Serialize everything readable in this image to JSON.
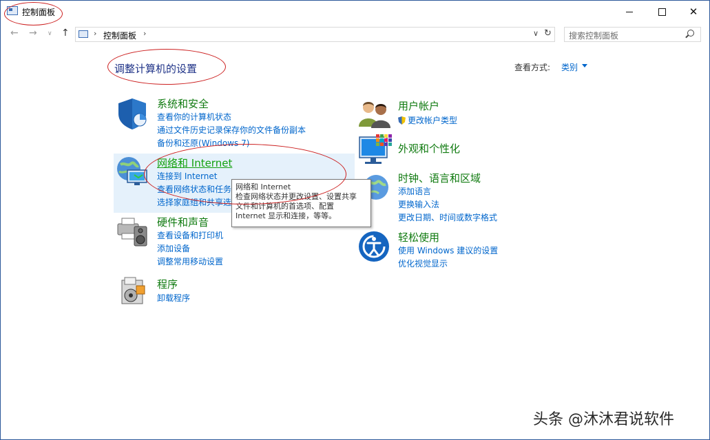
{
  "window": {
    "title": "控制面板"
  },
  "navbar": {
    "back_icon": "←",
    "forward_icon": "→",
    "recent_icon": "∨",
    "up_icon": "↑",
    "address": {
      "path_text": "控制面板",
      "separator": "›",
      "dropdown_icon": "∨",
      "refresh_icon": "↻"
    },
    "search": {
      "placeholder": "搜索控制面板"
    }
  },
  "main": {
    "heading": "调整计算机的设置",
    "view_by": {
      "label": "查看方式:",
      "value": "类别"
    },
    "categories_left": [
      {
        "title": "系统和安全",
        "links": [
          "查看你的计算机状态",
          "通过文件历史记录保存你的文件备份副本",
          "备份和还原(Windows 7)"
        ]
      },
      {
        "title": "网络和 Internet",
        "links": [
          "连接到 Internet",
          "查看网络状态和任务",
          "选择家庭组和共享选"
        ]
      },
      {
        "title": "硬件和声音",
        "links": [
          "查看设备和打印机",
          "添加设备",
          "调整常用移动设置"
        ]
      },
      {
        "title": "程序",
        "links": [
          "卸载程序"
        ]
      }
    ],
    "categories_right": [
      {
        "title": "用户帐户",
        "links": [
          "更改帐户类型"
        ]
      },
      {
        "title": "外观和个性化",
        "links": []
      },
      {
        "title": "时钟、语言和区域",
        "links": [
          "添加语言",
          "更换输入法",
          "更改日期、时间或数字格式"
        ]
      },
      {
        "title": "轻松使用",
        "links": [
          "使用 Windows 建议的设置",
          "优化视觉显示"
        ]
      }
    ]
  },
  "tooltip": {
    "lines": [
      "网络和 Internet",
      "检查网络状态并更改设置、设置共享",
      "文件和计算机的首选项、配置",
      "Internet 显示和连接，等等。"
    ]
  },
  "watermark": "头条 @沐沐君说软件",
  "colors": {
    "link": "#0066cc",
    "category_title": "#0f7a0f",
    "heading": "#1e3287",
    "annotation": "#cc1f1f",
    "hover_bg": "#e5f1fb"
  }
}
